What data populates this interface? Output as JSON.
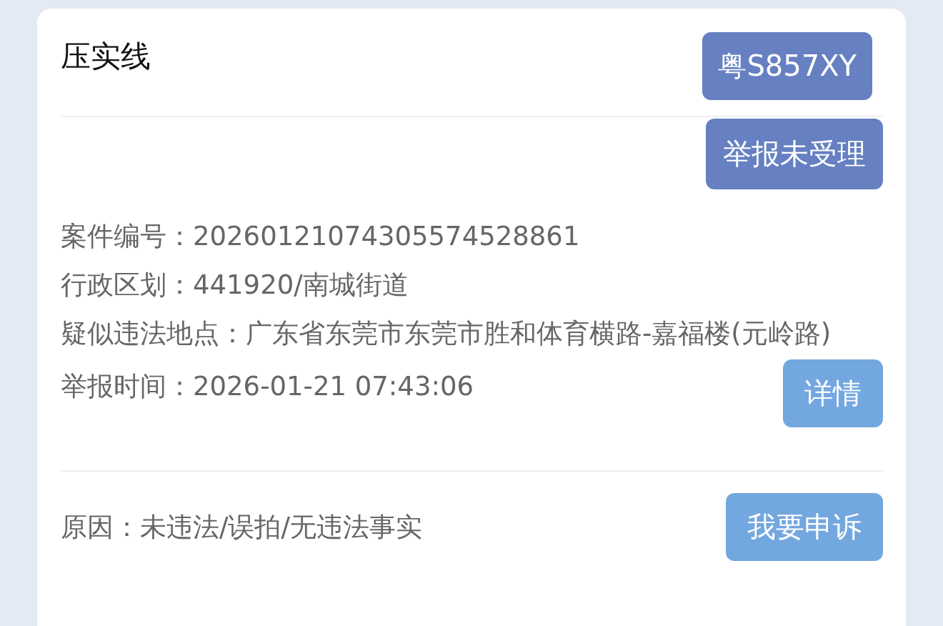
{
  "card": {
    "title": "压实线",
    "plate": "粤S857XY",
    "status": "举报未受理",
    "fields": [
      {
        "label": "案件编号：",
        "value": "20260121074305574528861"
      },
      {
        "label": "行政区划：",
        "value": "441920/南城街道"
      },
      {
        "label": "疑似违法地点：",
        "value": "广东省东莞市东莞市胜和体育横路-嘉福楼(元岭路)"
      },
      {
        "label": "举报时间：",
        "value": "2026-01-21 07:43:06"
      }
    ],
    "detail_button": "详情",
    "reason": {
      "label": "原因：",
      "value": "未违法/误拍/无违法事实"
    },
    "appeal_button": "我要申诉"
  }
}
